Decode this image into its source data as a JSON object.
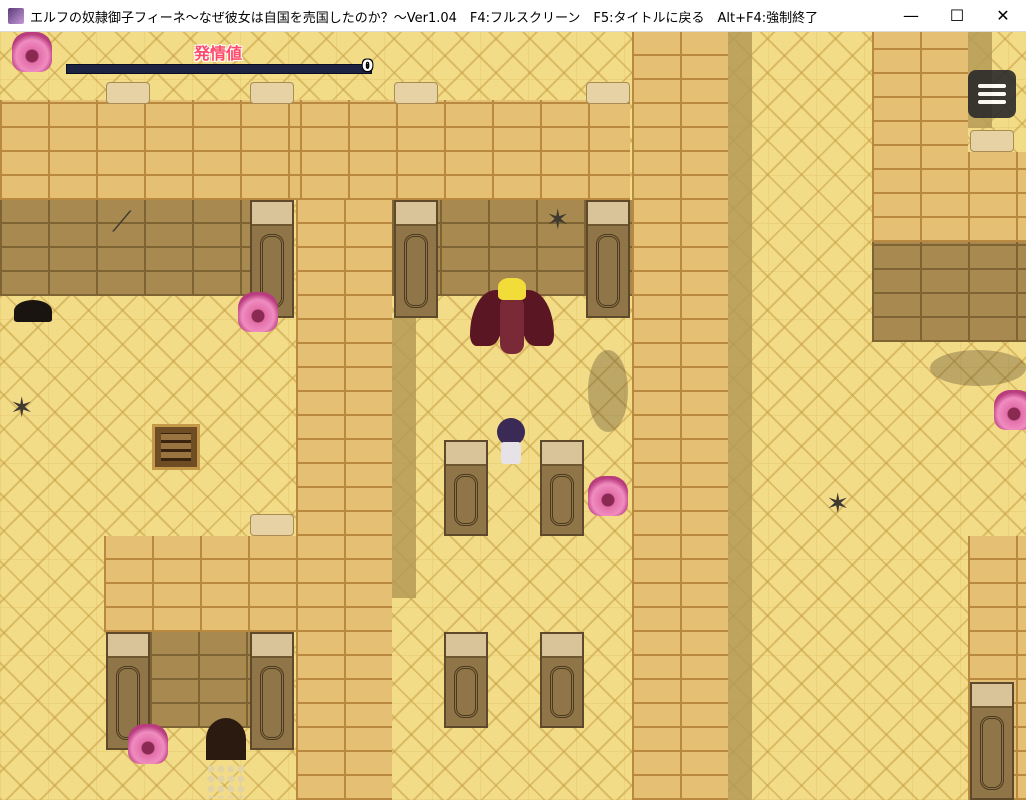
{
  "window": {
    "title": "エルフの奴隷御子フィーネ～なぜ彼女は自国を売国したのか？～Ver1.04　F4:フルスクリーン　F5:タイトルに戻る　Alt+F4:強制終了",
    "minimize": "—",
    "maximize": "☐",
    "close": "✕"
  },
  "hud": {
    "label": "発情値",
    "value": "0",
    "bar_fill": 0
  },
  "icons": {
    "app": "app-icon",
    "menu": "hamburger-menu-icon"
  }
}
